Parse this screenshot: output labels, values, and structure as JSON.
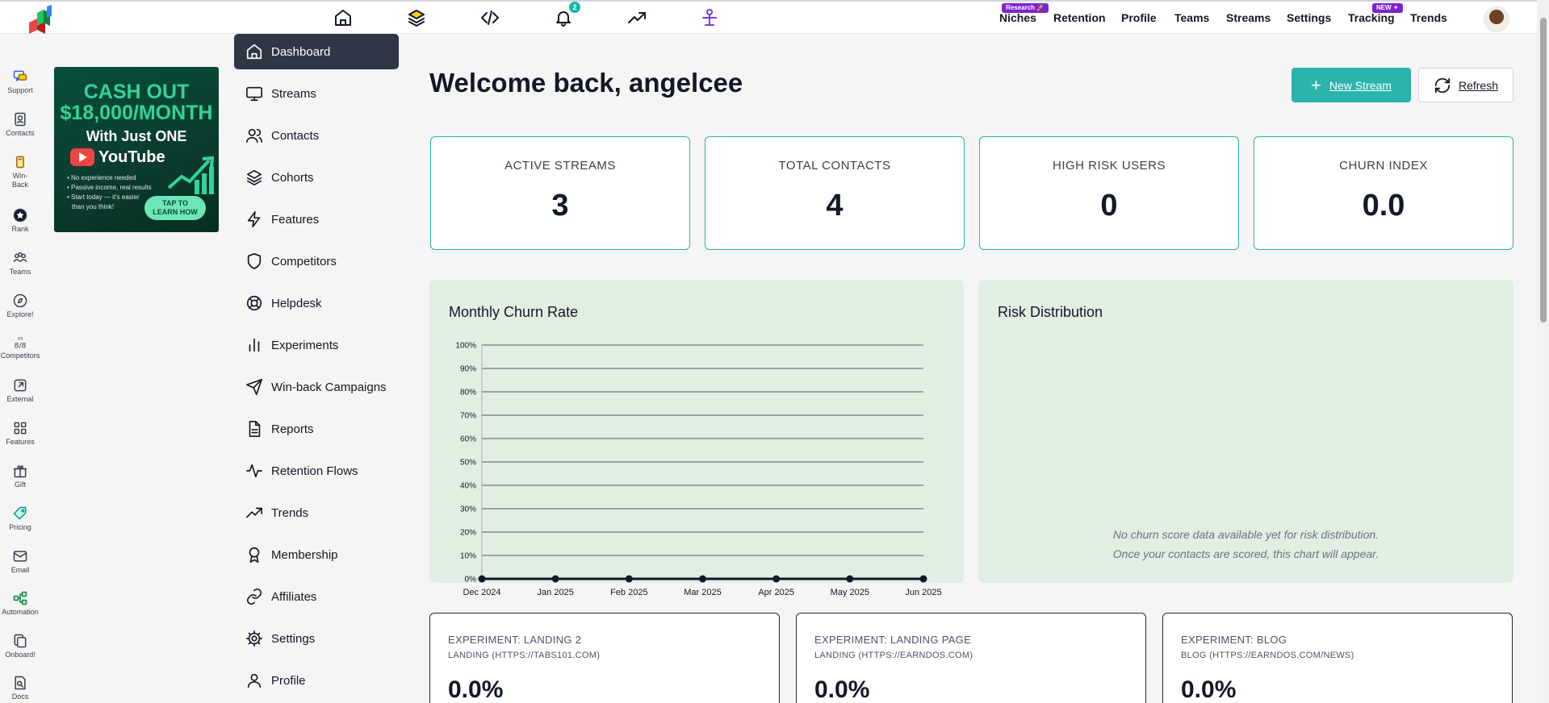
{
  "topbar": {
    "notification_count": "2",
    "nav": [
      {
        "label": "Niches",
        "badge": "Research 🚀"
      },
      {
        "label": "Retention"
      },
      {
        "label": "Profile"
      },
      {
        "label": "Teams"
      },
      {
        "label": "Streams"
      },
      {
        "label": "Settings"
      },
      {
        "label": "Tracking",
        "badge": "NEW ✦"
      },
      {
        "label": "Trends"
      }
    ]
  },
  "rail": [
    {
      "label": "Support",
      "icon": "support-icon"
    },
    {
      "label": "Contacts",
      "icon": "contacts-icon"
    },
    {
      "label": "Win-Back",
      "icon": "win-back-icon"
    },
    {
      "label": "Rank",
      "icon": "rank-icon"
    },
    {
      "label": "Teams",
      "icon": "teams-icon"
    },
    {
      "label": "Explore!",
      "icon": "explore-icon"
    },
    {
      "label": "Competitors",
      "icon": "competitors-icon"
    },
    {
      "label": "External",
      "icon": "external-icon"
    },
    {
      "label": "Features",
      "icon": "features-icon"
    },
    {
      "label": "Gift",
      "icon": "gift-icon"
    },
    {
      "label": "Pricing",
      "icon": "pricing-icon"
    },
    {
      "label": "Email",
      "icon": "email-icon"
    },
    {
      "label": "Automation",
      "icon": "automation-icon"
    },
    {
      "label": "Onboard!",
      "icon": "onboard-icon"
    },
    {
      "label": "Docs",
      "icon": "docs-icon"
    }
  ],
  "ad": {
    "line1": "CASH OUT",
    "line2": "$18,000/MONTH",
    "line3": "With Just ONE",
    "brand": "YouTube",
    "bullets": [
      "• No experience needed",
      "• Passive income, real results",
      "• Start today — it's easier",
      "  than you think!"
    ],
    "cta1": "TAP TO",
    "cta2": "LEARN HOW"
  },
  "nav": [
    {
      "label": "Dashboard",
      "icon": "home-icon",
      "active": true
    },
    {
      "label": "Streams",
      "icon": "monitor-icon"
    },
    {
      "label": "Contacts",
      "icon": "users-icon"
    },
    {
      "label": "Cohorts",
      "icon": "layers-icon"
    },
    {
      "label": "Features",
      "icon": "lightning-icon"
    },
    {
      "label": "Competitors",
      "icon": "shield-icon"
    },
    {
      "label": "Helpdesk",
      "icon": "lifebuoy-icon"
    },
    {
      "label": "Experiments",
      "icon": "bar-chart-icon"
    },
    {
      "label": "Win-back Campaigns",
      "icon": "send-icon"
    },
    {
      "label": "Reports",
      "icon": "document-icon"
    },
    {
      "label": "Retention Flows",
      "icon": "activity-icon"
    },
    {
      "label": "Trends",
      "icon": "trending-up-icon"
    },
    {
      "label": "Membership",
      "icon": "award-icon"
    },
    {
      "label": "Affiliates",
      "icon": "link-icon"
    },
    {
      "label": "Settings",
      "icon": "gear-icon"
    },
    {
      "label": "Profile",
      "icon": "user-icon"
    }
  ],
  "main": {
    "welcome": "Welcome back, angelcee",
    "new_stream_label": "New Stream",
    "refresh_label": "Refresh",
    "stats": [
      {
        "label": "ACTIVE STREAMS",
        "value": "3"
      },
      {
        "label": "TOTAL CONTACTS",
        "value": "4"
      },
      {
        "label": "HIGH RISK USERS",
        "value": "0"
      },
      {
        "label": "CHURN INDEX",
        "value": "0.0"
      }
    ],
    "churn_panel_title": "Monthly Churn Rate",
    "risk_panel_title": "Risk Distribution",
    "risk_empty_line1": "No churn score data available yet for risk distribution.",
    "risk_empty_line2": "Once your contacts are scored, this chart will appear.",
    "experiments": [
      {
        "title": "EXPERIMENT: LANDING 2",
        "subtitle": "LANDING (HTTPS://TABS101.COM)",
        "value": "0.0%"
      },
      {
        "title": "EXPERIMENT: LANDING PAGE",
        "subtitle": "LANDING (HTTPS://EARNDOS.COM)",
        "value": "0.0%"
      },
      {
        "title": "EXPERIMENT: BLOG",
        "subtitle": "BLOG (HTTPS://EARNDOS.COM/NEWS)",
        "value": "0.0%"
      }
    ]
  },
  "colors": {
    "accent": "#2bb3ad",
    "nav_active": "#2f3747",
    "panel_bg": "#e1efe3",
    "badge_purple": "#7e22ce"
  },
  "chart_data": {
    "type": "line",
    "title": "Monthly Churn Rate",
    "x": [
      "Dec 2024",
      "Jan 2025",
      "Feb 2025",
      "Mar 2025",
      "Apr 2025",
      "May 2025",
      "Jun 2025"
    ],
    "series": [
      {
        "values": [
          0,
          0,
          0,
          0,
          0,
          0,
          0
        ]
      }
    ],
    "yticks": [
      "0%",
      "10%",
      "20%",
      "30%",
      "40%",
      "50%",
      "60%",
      "70%",
      "80%",
      "90%",
      "100%"
    ],
    "ylim": [
      0,
      100
    ],
    "grid": true,
    "xlabel": "",
    "ylabel": ""
  }
}
